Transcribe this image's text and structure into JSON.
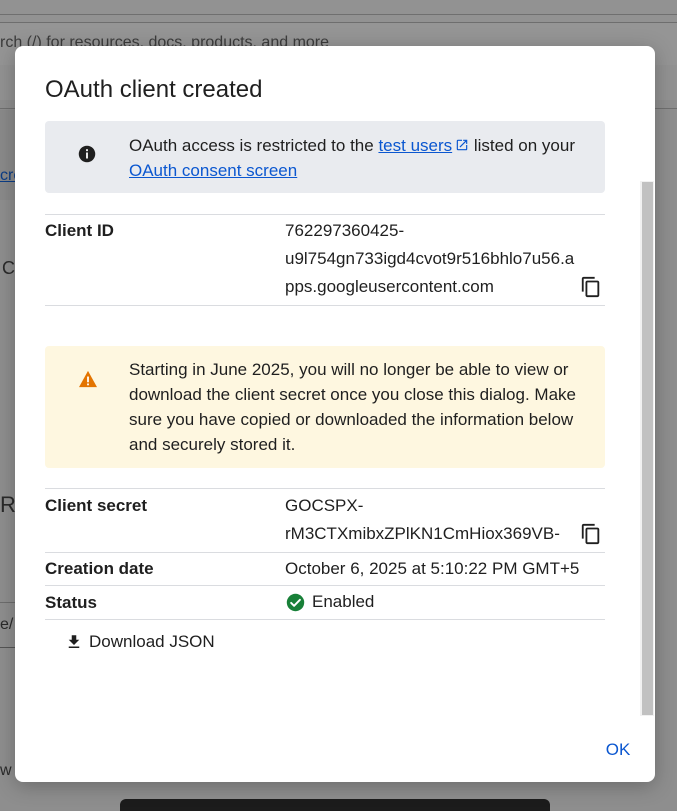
{
  "background": {
    "search_placeholder": "rch (/) for resources, docs, products, and more",
    "fragment_c": "C",
    "fragment_cre": "cre",
    "fragment_rls": "RIs",
    "fragment_e": "e/",
    "fragment_wh": "w h"
  },
  "dialog": {
    "title": "OAuth client created",
    "info": {
      "text_before": "OAuth access is restricted to the ",
      "link_test_users": "test users",
      "text_middle": " listed on your ",
      "link_consent": "OAuth consent screen",
      "icon": "info-icon"
    },
    "client_id": {
      "label": "Client ID",
      "line1": "762297360425-",
      "line2": "u9l754gn733igd4cvot9r516bhlo7u56.a",
      "line3": "pps.googleusercontent.com",
      "copy_icon": "copy-icon"
    },
    "warning": {
      "text": "Starting in June 2025, you will no longer be able to view or download the client secret once you close this dialog. Make sure you have copied or downloaded the information below and securely stored it.",
      "icon": "warning-icon",
      "color": "#e37400"
    },
    "client_secret": {
      "label": "Client secret",
      "line1": "GOCSPX-",
      "line2": "rM3CTXmibxZPlKN1CmHiox369VB-",
      "copy_icon": "copy-icon"
    },
    "creation_date": {
      "label": "Creation date",
      "value": "October 6, 2025 at 5:10:22 PM GMT+5"
    },
    "status": {
      "label": "Status",
      "value": "Enabled",
      "color": "#188038"
    },
    "download_label": "Download JSON",
    "ok_label": "OK",
    "accent_color": "#0b57d0"
  }
}
